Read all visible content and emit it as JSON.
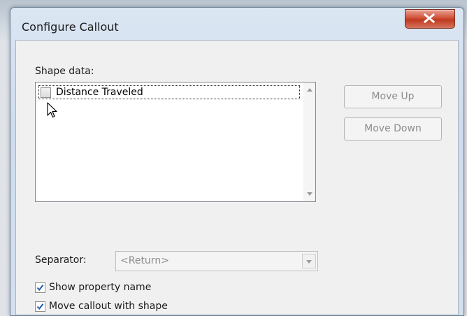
{
  "window": {
    "title": "Configure Callout",
    "close_glyph": "X"
  },
  "shape_data": {
    "label": "Shape data:",
    "items": [
      {
        "label": "Distance Traveled",
        "checked": false,
        "focused": true
      }
    ]
  },
  "buttons": {
    "move_up": "Move Up",
    "move_down": "Move Down"
  },
  "separator": {
    "label": "Separator:",
    "value": "<Return>"
  },
  "options": {
    "show_property_name": {
      "label": "Show property name",
      "checked": true
    },
    "move_with_shape": {
      "label": "Move callout with shape",
      "checked": true
    }
  },
  "colors": {
    "accent_check": "#1f5aa8",
    "close_button": "#c0391f"
  }
}
